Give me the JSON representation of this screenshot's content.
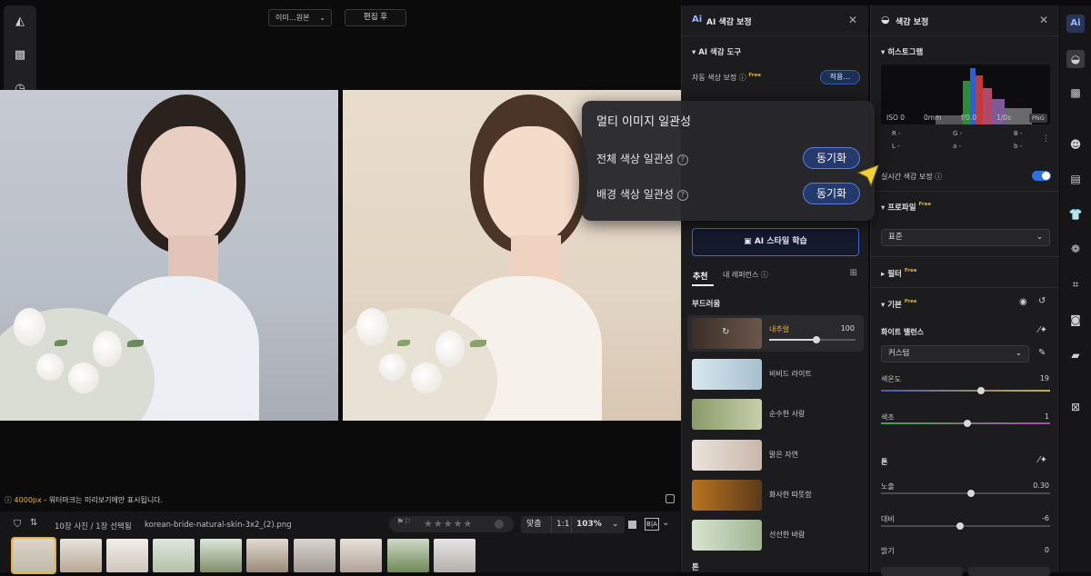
{
  "view": {
    "mode_select": "이미…원본",
    "edit_button": "편집 후",
    "watermark_px": "4000px",
    "watermark_text": " - 워터마크는 미리보기에만 표시됩니다."
  },
  "filmstrip": {
    "count_text": "10장 사진 / 1장 선택됨",
    "filename": "korean-bride-natural-skin-3x2_(2).png",
    "fit_label": "맞춤",
    "one_to_one": "1:1",
    "zoom": "103%",
    "rating_stars": 0
  },
  "ai_panel": {
    "title": "AI 색감 보정",
    "tools_section": "AI 색감 도구",
    "auto_color_label": "자동 색상 보정",
    "free_badge": "Free",
    "apply_button": "적용…",
    "style_learn_button": "AI 스타일 학습",
    "tab_recommend": "추천",
    "tab_my_reference": "내 레퍼런스",
    "softness_section": "부드러움",
    "selected_style": {
      "name": "내추럴",
      "value": "100",
      "level": 1.0
    },
    "styles": [
      "비비드 라이트",
      "순수한 사랑",
      "맑은 자연",
      "화사한 따뜻함",
      "선선한 바람"
    ],
    "bottom_section": "톤"
  },
  "popup": {
    "title": "멀티 이미지 일관성",
    "row1_label": "전체 색상 일관성",
    "row2_label": "배경 색상 일관성",
    "sync_button": "동기화"
  },
  "color_panel": {
    "title": "색감 보정",
    "histogram_section": "히스토그램",
    "exif": {
      "iso": "ISO 0",
      "focal": "0mm",
      "aperture": "f/0.0",
      "shutter": "1/0s",
      "format": "PNG"
    },
    "rgb": {
      "r": "R -",
      "g": "G -",
      "b": "B -",
      "l": "L -",
      "a": "a -",
      "bb": "b -"
    },
    "realtime_label": "실시간 색감 보정",
    "realtime_on": true,
    "profile_section": "프로파일",
    "profile_value": "표준",
    "filter_section": "필터",
    "basic_section": "기본",
    "wb_label": "화이트 밸런스",
    "wb_value": "커스텀",
    "temp_label": "색온도",
    "temp_value": "19",
    "temp_level": 0.59,
    "tint_label": "색조",
    "tint_value": "1",
    "tint_level": 0.51,
    "tone_section": "톤",
    "exposure_label": "노출",
    "exposure_value": "0.30",
    "exposure_level": 0.53,
    "contrast_label": "대비",
    "contrast_value": "-6",
    "contrast_level": 0.47,
    "brightness_label": "밝기",
    "brightness_value": "0"
  },
  "colors": {
    "accent_gold": "#e3b341",
    "accent_blue": "#3d68d8"
  }
}
